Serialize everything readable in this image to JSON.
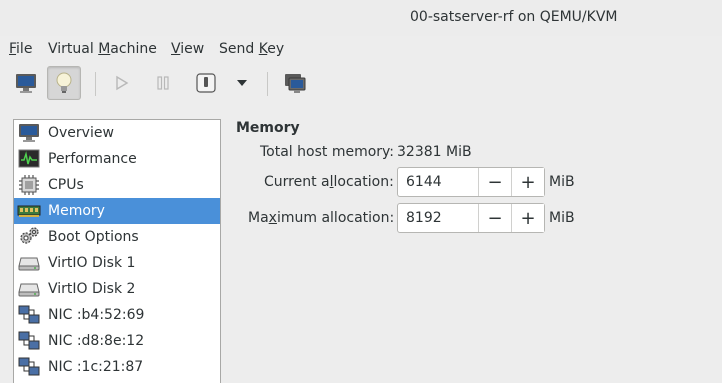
{
  "window": {
    "title": "00-satserver-rf on QEMU/KVM"
  },
  "menubar": {
    "items": [
      {
        "label": "File",
        "mnemonic_index": 0
      },
      {
        "label": "Virtual Machine",
        "mnemonic_index": 8
      },
      {
        "label": "View",
        "mnemonic_index": 0
      },
      {
        "label": "Send Key",
        "mnemonic_index": 5
      }
    ]
  },
  "toolbar": {
    "buttons": [
      {
        "name": "console-view",
        "icon": "monitor-icon",
        "active": false
      },
      {
        "name": "details-view",
        "icon": "lightbulb-icon",
        "active": true
      },
      {
        "name": "run",
        "icon": "play-icon",
        "enabled": false
      },
      {
        "name": "pause",
        "icon": "pause-icon",
        "enabled": false
      },
      {
        "name": "shutdown",
        "icon": "power-icon",
        "enabled": true
      },
      {
        "name": "shutdown-menu",
        "icon": "chevron-down-icon",
        "enabled": true
      },
      {
        "name": "fullscreen",
        "icon": "fullscreen-icon",
        "enabled": true
      }
    ]
  },
  "sidebar": {
    "items": [
      {
        "label": "Overview",
        "icon": "monitor-icon",
        "selected": false
      },
      {
        "label": "Performance",
        "icon": "performance-graph-icon",
        "selected": false
      },
      {
        "label": "CPUs",
        "icon": "cpu-icon",
        "selected": false
      },
      {
        "label": "Memory",
        "icon": "memory-icon",
        "selected": true
      },
      {
        "label": "Boot Options",
        "icon": "gears-icon",
        "selected": false
      },
      {
        "label": "VirtIO Disk 1",
        "icon": "disk-icon",
        "selected": false
      },
      {
        "label": "VirtIO Disk 2",
        "icon": "disk-icon",
        "selected": false
      },
      {
        "label": "NIC :b4:52:69",
        "icon": "network-icon",
        "selected": false
      },
      {
        "label": "NIC :d8:8e:12",
        "icon": "network-icon",
        "selected": false
      },
      {
        "label": "NIC :1c:21:87",
        "icon": "network-icon",
        "selected": false
      }
    ]
  },
  "memory": {
    "section_title": "Memory",
    "total_host_label": "Total host memory:",
    "total_host_value": "32381 MiB",
    "current_label_pre": "Current a",
    "current_label_mn": "l",
    "current_label_post": "location:",
    "current_value": "6144",
    "max_label_pre": "Ma",
    "max_label_mn": "x",
    "max_label_post": "imum allocation:",
    "max_value": "8192",
    "unit": "MiB",
    "minus": "−",
    "plus": "+"
  },
  "colors": {
    "selection": "#4a90d9",
    "background": "#ededed"
  }
}
